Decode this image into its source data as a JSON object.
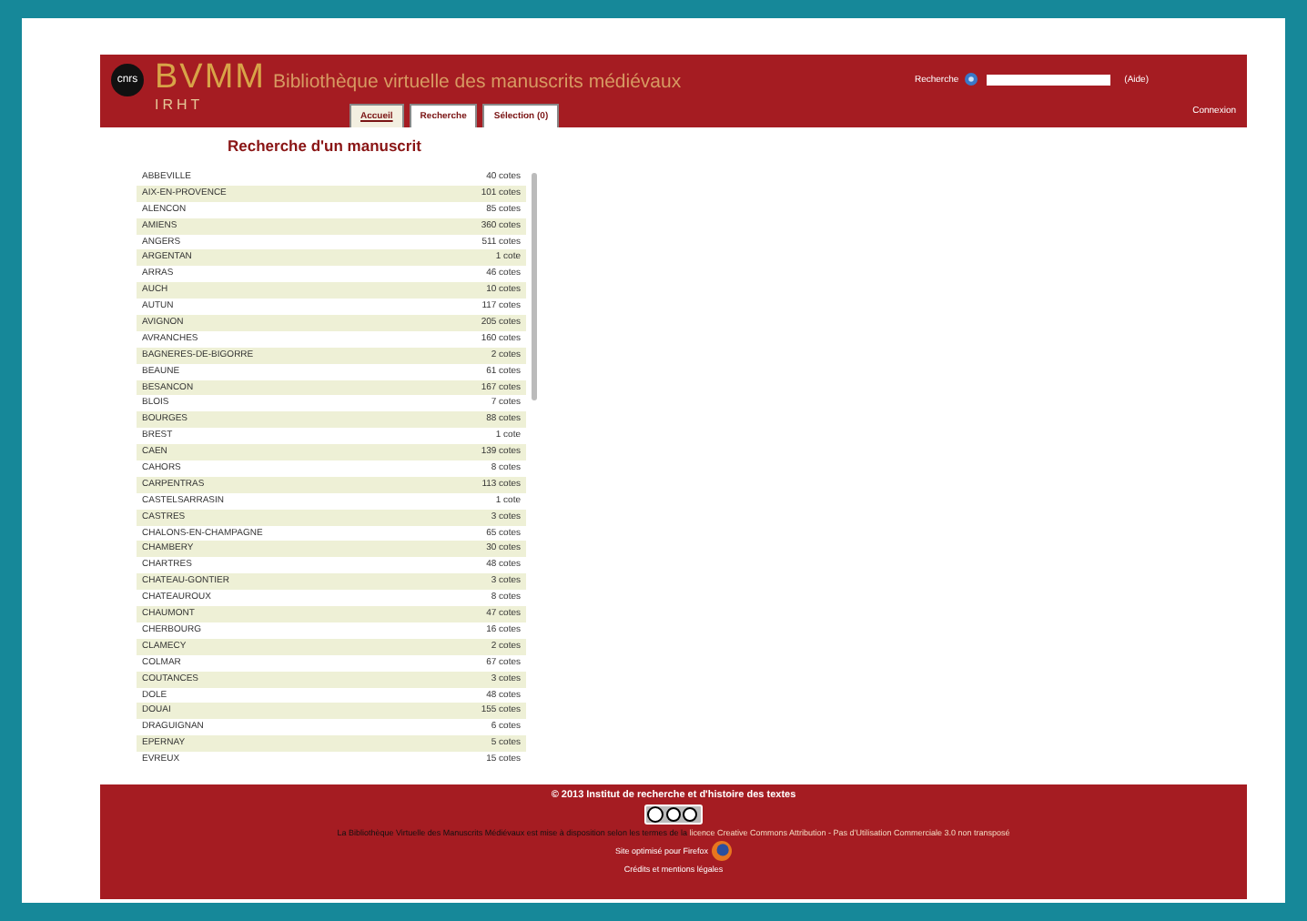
{
  "header": {
    "logo": "cnrs",
    "brand": "BVMM",
    "sub_brand": "IRHT",
    "title": "Bibliothèque virtuelle des manuscrits médiévaux",
    "search_label": "Recherche",
    "search_help": "(Aide)",
    "login": "Connexion"
  },
  "tabs": [
    {
      "label": "Accueil",
      "selected": true
    },
    {
      "label": "Recherche",
      "selected": false
    },
    {
      "label": "Sélection (0)",
      "selected": false
    }
  ],
  "heading": "Recherche d'un manuscrit",
  "cities": [
    {
      "name": "ABBEVILLE",
      "count": "40 cotes"
    },
    {
      "name": "AIX-EN-PROVENCE",
      "count": "101 cotes"
    },
    {
      "name": "ALENCON",
      "count": "85 cotes"
    },
    {
      "name": "AMIENS",
      "count": "360 cotes"
    },
    {
      "name": "ANGERS",
      "count": "511 cotes"
    },
    {
      "name": "ARGENTAN",
      "count": "1 cote"
    },
    {
      "name": "ARRAS",
      "count": "46 cotes"
    },
    {
      "name": "AUCH",
      "count": "10 cotes"
    },
    {
      "name": "AUTUN",
      "count": "117 cotes"
    },
    {
      "name": "AVIGNON",
      "count": "205 cotes"
    },
    {
      "name": "AVRANCHES",
      "count": "160 cotes"
    },
    {
      "name": "BAGNERES-DE-BIGORRE",
      "count": "2 cotes"
    },
    {
      "name": "BEAUNE",
      "count": "61 cotes"
    },
    {
      "name": "BESANCON",
      "count": "167 cotes"
    },
    {
      "name": "BLOIS",
      "count": "7 cotes"
    },
    {
      "name": "BOURGES",
      "count": "88 cotes"
    },
    {
      "name": "BREST",
      "count": "1 cote"
    },
    {
      "name": "CAEN",
      "count": "139 cotes"
    },
    {
      "name": "CAHORS",
      "count": "8 cotes"
    },
    {
      "name": "CARPENTRAS",
      "count": "113 cotes"
    },
    {
      "name": "CASTELSARRASIN",
      "count": "1 cote"
    },
    {
      "name": "CASTRES",
      "count": "3 cotes"
    },
    {
      "name": "CHALONS-EN-CHAMPAGNE",
      "count": "65 cotes"
    },
    {
      "name": "CHAMBERY",
      "count": "30 cotes"
    },
    {
      "name": "CHARTRES",
      "count": "48 cotes"
    },
    {
      "name": "CHATEAU-GONTIER",
      "count": "3 cotes"
    },
    {
      "name": "CHATEAUROUX",
      "count": "8 cotes"
    },
    {
      "name": "CHAUMONT",
      "count": "47 cotes"
    },
    {
      "name": "CHERBOURG",
      "count": "16 cotes"
    },
    {
      "name": "CLAMECY",
      "count": "2 cotes"
    },
    {
      "name": "COLMAR",
      "count": "67 cotes"
    },
    {
      "name": "COUTANCES",
      "count": "3 cotes"
    },
    {
      "name": "DOLE",
      "count": "48 cotes"
    },
    {
      "name": "DOUAI",
      "count": "155 cotes"
    },
    {
      "name": "DRAGUIGNAN",
      "count": "6 cotes"
    },
    {
      "name": "EPERNAY",
      "count": "5 cotes"
    },
    {
      "name": "EVREUX",
      "count": "15 cotes"
    }
  ],
  "footer": {
    "copyright": "© 2013 Institut de recherche et d'histoire des textes",
    "license_text": "La Bibliothèque Virtuelle des Manuscrits Médiévaux est mise à disposition selon les termes de la",
    "license_link": "licence Creative Commons Attribution - Pas d’Utilisation Commerciale 3.0 non transposé",
    "browser_note": "Site optimisé pour Firefox",
    "credits": "Crédits et mentions légales"
  }
}
